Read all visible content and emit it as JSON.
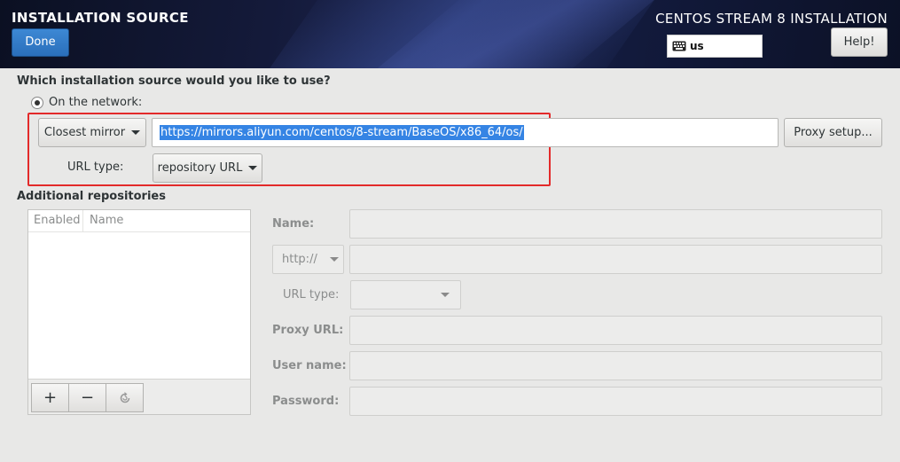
{
  "header": {
    "title": "INSTALLATION SOURCE",
    "done_label": "Done",
    "product": "CENTOS STREAM 8 INSTALLATION",
    "keyboard_layout": "us",
    "help_label": "Help!"
  },
  "source": {
    "question": "Which installation source would you like to use?",
    "network_option": "On the network:",
    "mirror_select": "Closest mirror",
    "url_value": "https://mirrors.aliyun.com/centos/8-stream/BaseOS/x86_64/os/",
    "proxy_button": "Proxy setup...",
    "url_type_label": "URL type:",
    "url_type_value": "repository URL"
  },
  "additional": {
    "section_label": "Additional repositories",
    "columns": [
      "Enabled",
      "Name"
    ],
    "add_label": "+",
    "remove_label": "−",
    "form": {
      "name_label": "Name:",
      "protocol_value": "http://",
      "url_type_label": "URL type:",
      "proxy_url_label": "Proxy URL:",
      "user_name_label": "User name:",
      "password_label": "Password:"
    }
  },
  "colors": {
    "accent": "#3584e4",
    "highlight_box": "#e32a2a"
  },
  "icons": {
    "keyboard": "keyboard-icon",
    "refresh": "refresh-icon"
  }
}
